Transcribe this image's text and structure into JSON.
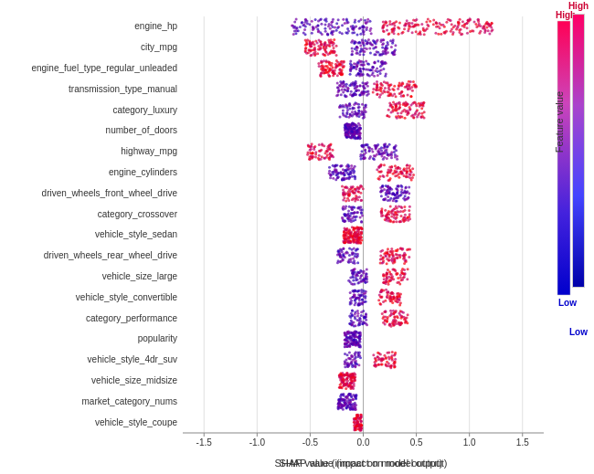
{
  "chart": {
    "title": "SHAP value (impact on model output)",
    "x_axis_label": "SHAP value (impact on model output)",
    "x_ticks": [
      "-1.5",
      "-1.0",
      "-0.5",
      "0.0",
      "0.5",
      "1.0",
      "1.5"
    ],
    "features": [
      "engine_hp",
      "city_mpg",
      "engine_fuel_type_regular_unleaded",
      "transmission_type_manual",
      "category_luxury",
      "number_of_doors",
      "highway_mpg",
      "engine_cylinders",
      "driven_wheels_front_wheel_drive",
      "category_crossover",
      "vehicle_style_sedan",
      "driven_wheels_rear_wheel_drive",
      "vehicle_size_large",
      "vehicle_style_convertible",
      "category_performance",
      "popularity",
      "vehicle_style_4dr_suv",
      "vehicle_size_midsize",
      "market_category_nums",
      "vehicle_style_coupe"
    ],
    "colorbar": {
      "high_label": "High",
      "low_label": "Low",
      "feature_value_label": "Feature value"
    }
  }
}
